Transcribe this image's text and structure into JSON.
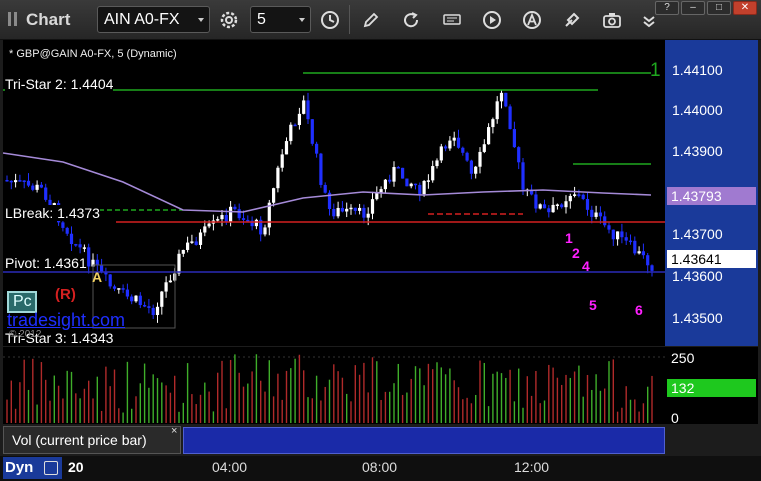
{
  "toolbar": {
    "title": "Chart",
    "symbol": "AIN A0-FX",
    "interval": "5"
  },
  "window_controls": {
    "help": "?",
    "minimize": "–",
    "maximize": "□",
    "close": "✕"
  },
  "chart": {
    "header": "* GBP@GAIN A0-FX, 5 (Dynamic)",
    "tri_star_2": "Tri-Star 2: 1.4404",
    "lbreak": "LBreak: 1.4373",
    "pivot": "Pivot: 1.4361",
    "tri_star_3": "Tri-Star 3: 1.4343",
    "watermark": "tradesight.com",
    "copyright": "© 2012",
    "pc_badge": "Pc",
    "r_badge": "(R)",
    "marker_a": "A",
    "marker_1": "1",
    "seq_labels": [
      "1",
      "2",
      "4",
      "5",
      "6"
    ]
  },
  "price_axis": {
    "ticks": [
      "1.44100",
      "1.44000",
      "1.43900",
      "1.43700",
      "1.43600",
      "1.43500"
    ],
    "lbreak_tag": "1.43793",
    "last_tag": "1.43641"
  },
  "volume": {
    "ticks": [
      "250",
      "0"
    ],
    "current_tag": "132",
    "study_label": "Vol (current price bar)",
    "close_x": "×"
  },
  "time_axis": {
    "study_label": "Dyn",
    "day": "20",
    "times": [
      "04:00",
      "08:00",
      "12:00"
    ]
  },
  "colors": {
    "up_candle": "#ffffff",
    "down_candle": "#1f2fff",
    "green_line": "#1fa81f",
    "red_line": "#d42020",
    "pivot_line": "#2a2ab8",
    "ma_line": "#a58ad8",
    "axis_bg": "#1a3a9a",
    "lbreak_tag_bg": "#a07ad0",
    "vol_tag_bg": "#1ec81e",
    "seq_magenta": "#ff20ff"
  },
  "icons": {
    "grip": "grip-icon",
    "settings": "gear-icon",
    "clock": "clock-icon",
    "pencil": "pencil-icon",
    "refresh": "refresh-icon",
    "get": "get-icon",
    "play": "play-icon",
    "a_circle": "a-circle-icon",
    "tools": "tools-icon",
    "camera": "camera-icon",
    "more": "chevron-icon"
  }
}
